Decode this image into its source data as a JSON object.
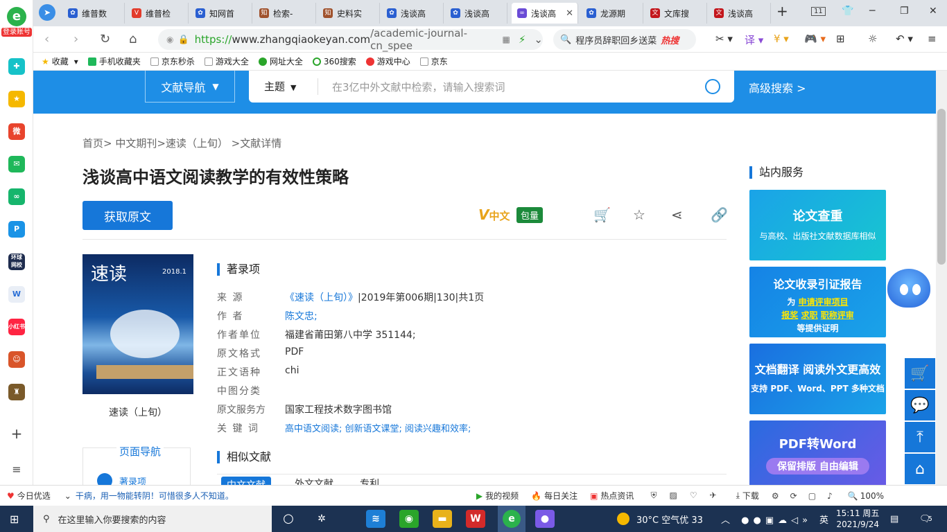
{
  "sidebar": {
    "login_label": "登录账号",
    "apps": [
      "应用1",
      "收藏",
      "微博",
      "邮箱",
      "应用5",
      "P",
      "环球网校",
      "文档",
      "小红书",
      "游戏1",
      "游戏2"
    ]
  },
  "tabs": [
    {
      "label": "维普数"
    },
    {
      "label": "维普检"
    },
    {
      "label": "知网首"
    },
    {
      "label": "检索-"
    },
    {
      "label": "史料实"
    },
    {
      "label": "浅谈高"
    },
    {
      "label": "浅谈高"
    },
    {
      "label": "浅谈高"
    },
    {
      "label": "龙源期"
    },
    {
      "label": "文库搜"
    },
    {
      "label": "浅谈高"
    }
  ],
  "tab_count": "11",
  "address": {
    "scheme": "https://",
    "host": "www.zhangqiaokeyan.com",
    "path": "/academic-journal-cn_spee"
  },
  "browser_search": {
    "text": "程序员辞职回乡送菜",
    "hot": "热搜"
  },
  "bookmarks": [
    "收藏",
    "手机收藏夹",
    "京东秒杀",
    "游戏大全",
    "网址大全",
    "360搜索",
    "游戏中心",
    "京东"
  ],
  "site_header": {
    "nav_button": "文献导航",
    "topic": "主题",
    "search_placeholder": "在3亿中外文献中检索，请输入搜索词",
    "advanced": "高级搜索  >"
  },
  "breadcrumb": "首页>  中文期刊>速读（上旬）  >文献详情",
  "article": {
    "title": "浅谈高中语文阅读教学的有效性策略",
    "get_button": "获取原文",
    "vzh_v": "V",
    "vzh_text": "中文",
    "baoliang": "包量",
    "cover_title": "速读",
    "cover_issue": "2018.1",
    "cover_caption": "速读（上旬）"
  },
  "catalog": {
    "heading": "著录项",
    "rows": [
      {
        "k": "来      源",
        "v": "《速读（上旬）》",
        "v2": "|2019年第006期|130|共1页"
      },
      {
        "k": "作      者",
        "v": "陈文忠;"
      },
      {
        "k": "作者单位",
        "v": "福建省莆田第八中学 351144;"
      },
      {
        "k": "原文格式",
        "v": "PDF"
      },
      {
        "k": "正文语种",
        "v": "chi"
      },
      {
        "k": "中图分类",
        "v": ""
      },
      {
        "k": "原文服务方",
        "v": "国家工程技术数字图书馆"
      },
      {
        "k": "关  键  词",
        "v": "高中语文阅读;   创新语文课堂;   阅读兴趣和效率;"
      }
    ]
  },
  "similar": {
    "heading": "相似文献",
    "tabs": [
      "中文文献",
      "外文文献",
      "专利"
    ]
  },
  "page_nav": {
    "heading": "页面导航",
    "item": "著录项"
  },
  "services": {
    "heading": "站内服务",
    "cards": [
      {
        "t1": "论文查重",
        "t2": "与高校、出版社文献数据库相似"
      },
      {
        "t1": "论文收录引证报告",
        "t2a": "为 ",
        "t2b": "申请评审项目",
        "t3a": "报奖",
        "t3b": "求职",
        "t3c": "职称评审",
        "t4": "等提供证明"
      },
      {
        "t1": "文档翻译 阅读外文更高效",
        "t2": "支持 PDF、Word、PPT 多种文档"
      },
      {
        "t1": "PDF转Word",
        "t2": "保留排版 自由编辑"
      }
    ]
  },
  "statusbar": {
    "left": "今日优选",
    "news": "干病，用一物能转阴！可惜很多人不知道。",
    "video": "我的视频",
    "daily": "每日关注",
    "hot": "热点资讯",
    "download": "下载",
    "zoom": "100%"
  },
  "taskbar": {
    "search": "在这里输入你要搜索的内容",
    "weather": "30°C  空气优 33",
    "ime": "英",
    "time": "15:11 周五",
    "date": "2021/9/24",
    "notif": "5"
  }
}
